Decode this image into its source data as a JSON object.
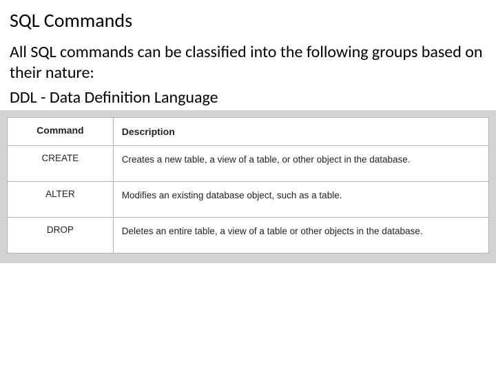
{
  "title": "SQL Commands",
  "intro": "All SQL commands can be classified into the following groups based on their nature:",
  "subheading": "DDL - Data Definition Language",
  "table": {
    "headers": {
      "command": "Command",
      "description": "Description"
    },
    "rows": [
      {
        "command": "CREATE",
        "description": "Creates a new table, a view of a table, or other object in the database."
      },
      {
        "command": "ALTER",
        "description": "Modifies an existing database object, such as a table."
      },
      {
        "command": "DROP",
        "description": "Deletes an entire table, a view of a table or other objects in the database."
      }
    ]
  }
}
